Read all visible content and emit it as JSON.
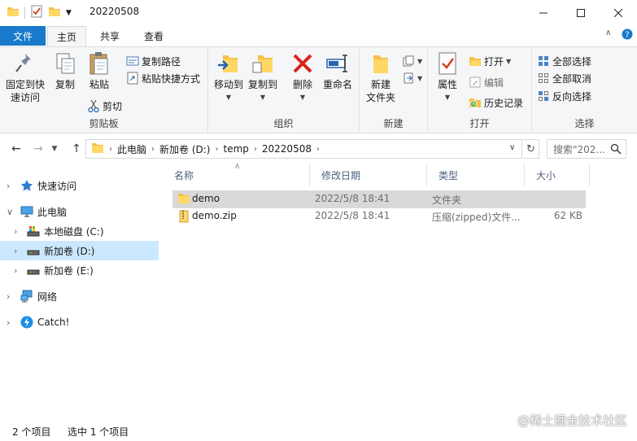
{
  "window": {
    "title": "20220508"
  },
  "ribbon_tabs": {
    "file": "文件",
    "home": "主页",
    "share": "共享",
    "view": "查看"
  },
  "ribbon": {
    "clipboard": {
      "pin": [
        "固定到快",
        "速访问"
      ],
      "copy": "复制",
      "paste": "粘贴",
      "copy_path": "复制路径",
      "paste_shortcut": "粘贴快捷方式",
      "cut": "剪切",
      "label": "剪贴板"
    },
    "organize": {
      "move_to": "移动到",
      "copy_to": "复制到",
      "delete": "删除",
      "rename": "重命名",
      "label": "组织"
    },
    "new": {
      "new_folder": [
        "新建",
        "文件夹"
      ],
      "label": "新建"
    },
    "open": {
      "properties": "属性",
      "open": "打开",
      "edit": "编辑",
      "history": "历史记录",
      "label": "打开"
    },
    "select": {
      "select_all": "全部选择",
      "select_none": "全部取消",
      "invert": "反向选择",
      "label": "选择"
    }
  },
  "address": {
    "crumbs": [
      "此电脑",
      "新加卷 (D:)",
      "temp",
      "20220508"
    ],
    "search_placeholder": "搜索\"202..."
  },
  "nav_pane": {
    "quick_access": "快速访问",
    "this_pc": "此电脑",
    "drive_c": "本地磁盘 (C:)",
    "drive_d": "新加卷 (D:)",
    "drive_e": "新加卷 (E:)",
    "network": "网络",
    "catch": "Catch!"
  },
  "columns": {
    "name": "名称",
    "date": "修改日期",
    "type": "类型",
    "size": "大小"
  },
  "files": [
    {
      "name": "demo",
      "date": "2022/5/8 18:41",
      "type": "文件夹",
      "size": "",
      "kind": "folder"
    },
    {
      "name": "demo.zip",
      "date": "2022/5/8 18:41",
      "type": "压缩(zipped)文件...",
      "size": "62 KB",
      "kind": "zip"
    }
  ],
  "status": {
    "count": "2 个项目",
    "selected": "选中 1 个项目"
  },
  "watermark": "@稀土掘金技术社区",
  "colors": {
    "accent": "#1979ca",
    "selection": "#cce8ff",
    "folder": "#f5c04a"
  }
}
